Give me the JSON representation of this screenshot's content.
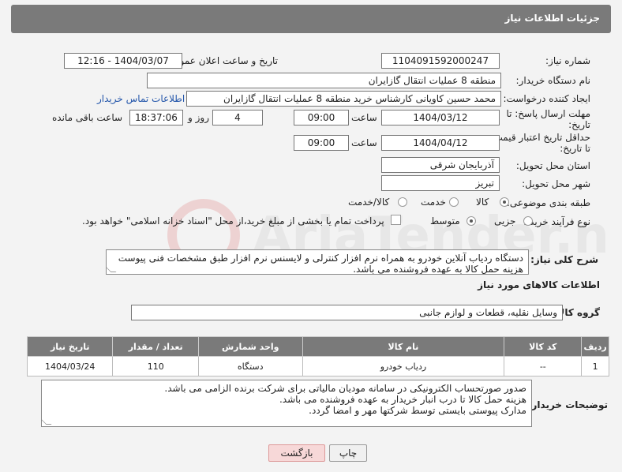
{
  "header": {
    "title": "جزئیات اطلاعات نیاز"
  },
  "fields": {
    "need_number_label": "شماره نیاز:",
    "need_number": "1104091592000247",
    "announce_label": "تاریخ و ساعت اعلان عمومی:",
    "announce_value": "1404/03/07 - 12:16",
    "buyer_org_label": "نام دستگاه خریدار:",
    "buyer_org": "منطقه 8 عملیات انتقال گازایران",
    "creator_label": "ایجاد کننده درخواست:",
    "creator": "محمد حسین کاویانی کارشناس خرید منطقه 8 عملیات انتقال گازایران",
    "contact_link": "اطلاعات تماس خریدار",
    "deadline_label_1": "مهلت ارسال پاسخ: تا",
    "deadline_label_2": "تاریخ:",
    "deadline_date": "1404/03/12",
    "time_label": "ساعت",
    "deadline_time": "09:00",
    "days_value": "4",
    "days_label": "روز و",
    "remaining_time": "18:37:06",
    "remaining_label": "ساعت باقی مانده",
    "min_price_label_1": "حداقل تاریخ اعتبار قیمت:",
    "min_price_label_2": "تا تاریخ:",
    "min_price_date": "1404/04/12",
    "min_price_time": "09:00",
    "province_label": "استان محل تحویل:",
    "province": "آذربایجان شرقی",
    "city_label": "شهر محل تحویل:",
    "city": "تبریز",
    "category_label": "طبقه بندی موضوعی:",
    "category_options": [
      "کالا",
      "خدمت",
      "کالا/خدمت"
    ],
    "process_label": "نوع فرآیند خرید :",
    "process_options": [
      "جزیی",
      "متوسط"
    ],
    "payment_note": "پرداخت تمام یا بخشی از مبلغ خرید،از محل \"اسناد خزانه اسلامی\" خواهد بود.",
    "description_label": "شرح کلی نیاز:",
    "description_lines": [
      "دستگاه ردیاب آنلاین خودرو به همراه نرم افزار کنترلی و لایسنس نرم افزار طبق مشخصات فنی پیوست",
      "هزینه حمل کالا به عهده فروشنده می باشد."
    ],
    "goods_info_title": "اطلاعات کالاهای مورد نیاز",
    "goods_group_label": "گروه کالا:",
    "goods_group": "وسایل نقلیه، قطعات و لوازم جانبی",
    "buyer_notes_label": "توضیحات خریدار:",
    "buyer_notes_lines": [
      "صدور صورتحساب الکترونیکی در سامانه مودیان مالیاتی برای شرکت برنده الزامی می باشد.",
      "هزینه حمل کالا تا درب انبار خریدار به عهده فروشنده می باشد.",
      "مدارک پیوستی بایستی توسط شرکتها مهر و امضا گردد."
    ]
  },
  "table": {
    "headers": [
      "ردیف",
      "کد کالا",
      "نام کالا",
      "واحد شمارش",
      "تعداد / مقدار",
      "تاریخ نیاز"
    ],
    "rows": [
      [
        "1",
        "--",
        "ردیاب خودرو",
        "دستگاه",
        "110",
        "1404/03/24"
      ]
    ]
  },
  "buttons": {
    "print": "چاپ",
    "back": "بازگشت"
  },
  "colors": {
    "header_bg": "#7a7a7a",
    "link": "#2255aa",
    "back_button": "#f7d8d8"
  }
}
